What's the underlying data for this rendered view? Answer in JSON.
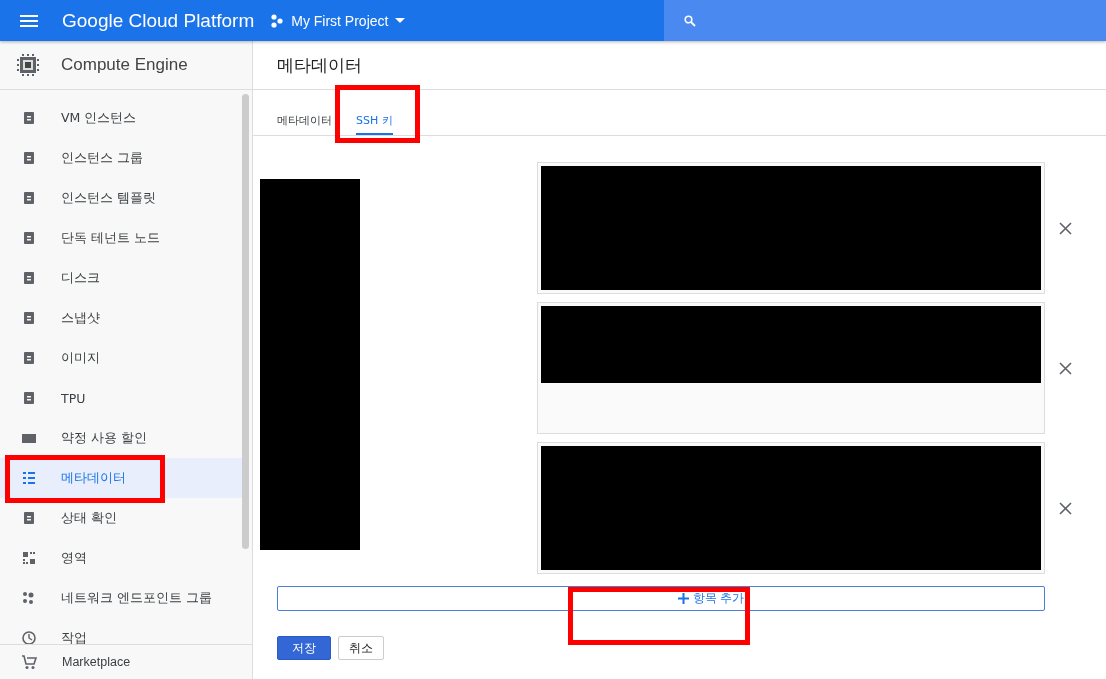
{
  "top_bar": {
    "brand": "Google Cloud Platform",
    "project": "My First Project"
  },
  "sidebar": {
    "title": "Compute Engine",
    "items": [
      {
        "label": "VM 인스턴스",
        "selected": false,
        "highlighted": false
      },
      {
        "label": "인스턴스 그룹",
        "selected": false,
        "highlighted": false
      },
      {
        "label": "인스턴스 템플릿",
        "selected": false,
        "highlighted": false
      },
      {
        "label": "단독 테넌트 노드",
        "selected": false,
        "highlighted": false
      },
      {
        "label": "디스크",
        "selected": false,
        "highlighted": false
      },
      {
        "label": "스냅샷",
        "selected": false,
        "highlighted": false
      },
      {
        "label": "이미지",
        "selected": false,
        "highlighted": false
      },
      {
        "label": "TPU",
        "selected": false,
        "highlighted": false
      },
      {
        "label": "약정 사용 할인",
        "selected": false,
        "highlighted": false
      },
      {
        "label": "메타데이터",
        "selected": true,
        "highlighted": true
      },
      {
        "label": "상태 확인",
        "selected": false,
        "highlighted": false
      },
      {
        "label": "영역",
        "selected": false,
        "highlighted": false
      },
      {
        "label": "네트워크 엔드포인트 그룹",
        "selected": false,
        "highlighted": false
      },
      {
        "label": "작업",
        "selected": false,
        "highlighted": false
      }
    ],
    "footer": "Marketplace"
  },
  "page": {
    "title": "메타데이터",
    "tabs": [
      {
        "label": "메타데이터",
        "selected": false,
        "highlighted": false
      },
      {
        "label": "SSH 키",
        "selected": true,
        "highlighted": true
      }
    ],
    "ssh_keys": [
      {
        "kind": "full"
      },
      {
        "kind": "partial"
      },
      {
        "kind": "full"
      }
    ],
    "add_item": {
      "label": "항목 추가",
      "highlighted": true
    },
    "buttons": [
      {
        "label": "저장",
        "kind": "primary"
      },
      {
        "label": "취소",
        "kind": "secondary"
      }
    ]
  }
}
